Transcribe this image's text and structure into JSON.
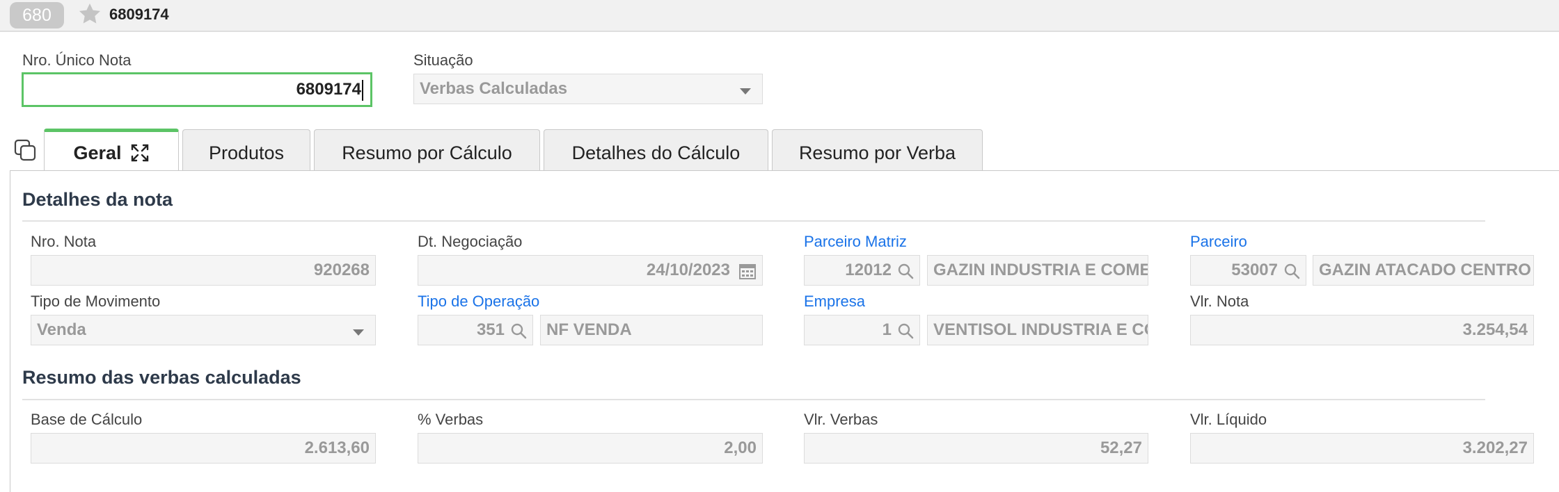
{
  "topbar": {
    "badge": "680",
    "record_title": "6809174"
  },
  "header": {
    "nro_unico_label": "Nro. Único Nota",
    "nro_unico_value": "6809174",
    "situacao_label": "Situação",
    "situacao_value": "Verbas Calculadas"
  },
  "tabs": [
    {
      "label": "Geral"
    },
    {
      "label": "Produtos"
    },
    {
      "label": "Resumo por Cálculo"
    },
    {
      "label": "Detalhes do Cálculo"
    },
    {
      "label": "Resumo por Verba"
    }
  ],
  "detalhes": {
    "title": "Detalhes da nota",
    "nro_nota_label": "Nro. Nota",
    "nro_nota_value": "920268",
    "dt_negociacao_label": "Dt. Negociação",
    "dt_negociacao_value": "24/10/2023",
    "parceiro_matriz_label": "Parceiro Matriz",
    "parceiro_matriz_code": "12012",
    "parceiro_matriz_name": "GAZIN INDUSTRIA E COMERCIO",
    "parceiro_label": "Parceiro",
    "parceiro_code": "53007",
    "parceiro_name": "GAZIN ATACADO CENTRO",
    "tipo_movimento_label": "Tipo de Movimento",
    "tipo_movimento_value": "Venda",
    "tipo_operacao_label": "Tipo de Operação",
    "tipo_operacao_code": "351",
    "tipo_operacao_name": "NF VENDA",
    "empresa_label": "Empresa",
    "empresa_code": "1",
    "empresa_name": "VENTISOL INDUSTRIA E COMERCIO",
    "vlr_nota_label": "Vlr. Nota",
    "vlr_nota_value": "3.254,54"
  },
  "resumo": {
    "title": "Resumo das verbas calculadas",
    "base_calculo_label": "Base de Cálculo",
    "base_calculo_value": "2.613,60",
    "pct_verbas_label": "% Verbas",
    "pct_verbas_value": "2,00",
    "vlr_verbas_label": "Vlr. Verbas",
    "vlr_verbas_value": "52,27",
    "vlr_liquido_label": "Vlr. Líquido",
    "vlr_liquido_value": "3.202,27"
  },
  "colors": {
    "accent_green": "#5cc466",
    "link_blue": "#1a73e8",
    "section_title": "#2e3a4a"
  }
}
